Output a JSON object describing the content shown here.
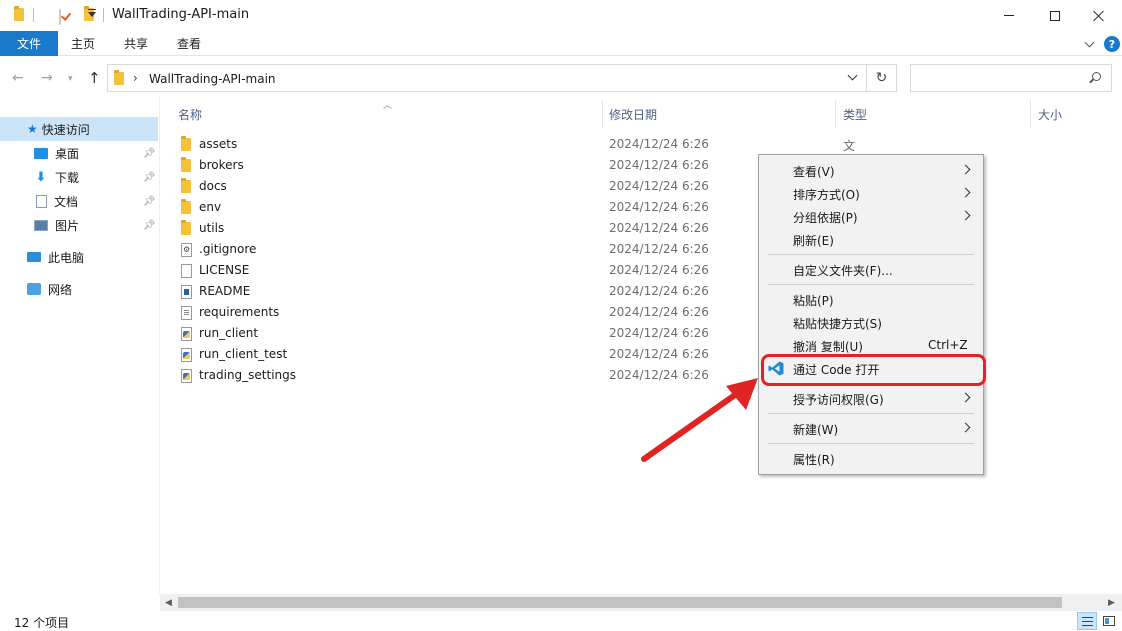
{
  "window": {
    "title": "WallTrading-API-main"
  },
  "ribbon": {
    "tabs": [
      "文件",
      "主页",
      "共享",
      "查看"
    ],
    "help": "?"
  },
  "address": {
    "path": "WallTrading-API-main",
    "separator": "›"
  },
  "sidebar": {
    "items": [
      {
        "label": "快速访问",
        "icon": "star-icon"
      },
      {
        "label": "桌面",
        "icon": "desktop-icon",
        "pinned": true
      },
      {
        "label": "下载",
        "icon": "download-icon",
        "pinned": true
      },
      {
        "label": "文档",
        "icon": "document-icon",
        "pinned": true
      },
      {
        "label": "图片",
        "icon": "pictures-icon",
        "pinned": true
      },
      {
        "label": "此电脑",
        "icon": "computer-icon"
      },
      {
        "label": "网络",
        "icon": "network-icon"
      }
    ]
  },
  "columns": {
    "name": "名称",
    "date": "修改日期",
    "type": "类型",
    "size": "大小"
  },
  "files": [
    {
      "name": "assets",
      "date": "2024/12/24 6:26",
      "type": "文件夹",
      "icon": "folder-icon"
    },
    {
      "name": "brokers",
      "date": "2024/12/24 6:26",
      "type": "",
      "icon": "folder-icon"
    },
    {
      "name": "docs",
      "date": "2024/12/24 6:26",
      "type": "",
      "icon": "folder-icon"
    },
    {
      "name": "env",
      "date": "2024/12/24 6:26",
      "type": "",
      "icon": "folder-icon"
    },
    {
      "name": "utils",
      "date": "2024/12/24 6:26",
      "type": "",
      "icon": "folder-icon"
    },
    {
      "name": ".gitignore",
      "date": "2024/12/24 6:26",
      "type": "",
      "icon": "gear-file-icon"
    },
    {
      "name": "LICENSE",
      "date": "2024/12/24 6:26",
      "type": "",
      "icon": "blank-file-icon"
    },
    {
      "name": "README",
      "date": "2024/12/24 6:26",
      "type": "",
      "icon": "markdown-file-icon"
    },
    {
      "name": "requirements",
      "date": "2024/12/24 6:26",
      "type": "",
      "icon": "text-file-icon"
    },
    {
      "name": "run_client",
      "date": "2024/12/24 6:26",
      "type": "",
      "icon": "python-file-icon"
    },
    {
      "name": "run_client_test",
      "date": "2024/12/24 6:26",
      "type": "",
      "icon": "python-file-icon"
    },
    {
      "name": "trading_settings",
      "date": "2024/12/24 6:26",
      "type": "",
      "icon": "python-file-icon"
    }
  ],
  "context_menu": {
    "items": [
      {
        "label": "查看(V)",
        "submenu": true
      },
      {
        "label": "排序方式(O)",
        "submenu": true
      },
      {
        "label": "分组依据(P)",
        "submenu": true
      },
      {
        "label": "刷新(E)"
      },
      {
        "label": "自定义文件夹(F)..."
      },
      {
        "label": "粘贴(P)"
      },
      {
        "label": "粘贴快捷方式(S)"
      },
      {
        "label": "撤消 复制(U)",
        "shortcut": "Ctrl+Z"
      },
      {
        "label": "通过 Code 打开",
        "icon": "vscode-icon",
        "highlighted": true
      },
      {
        "label": "授予访问权限(G)",
        "submenu": true
      },
      {
        "label": "新建(W)",
        "submenu": true
      },
      {
        "label": "属性(R)"
      }
    ]
  },
  "status": {
    "item_count": "12 个项目"
  },
  "colors": {
    "accent": "#1979ca",
    "selection": "#cce4f7",
    "folder": "#f3c13a",
    "annotation_red": "#e02424"
  }
}
